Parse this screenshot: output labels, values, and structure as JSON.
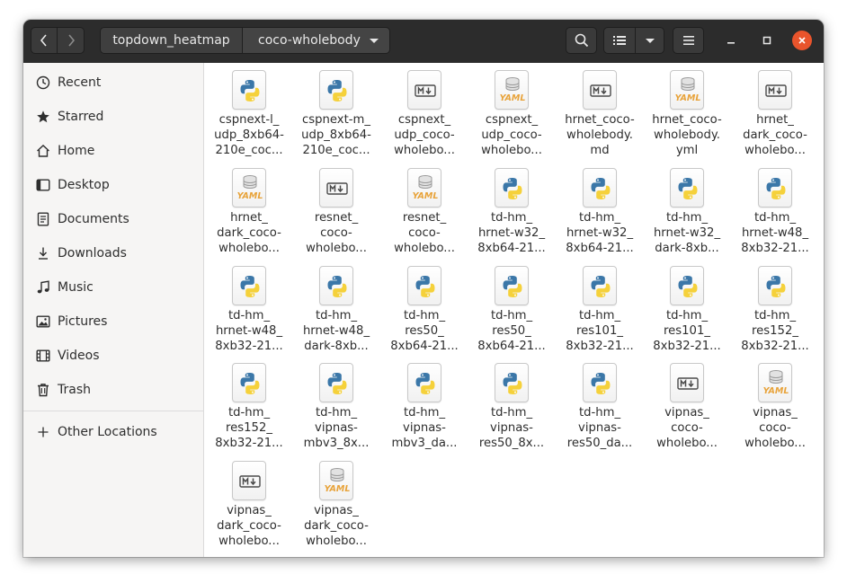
{
  "header": {
    "back_icon": "chevron-left-icon",
    "forward_icon": "chevron-right-icon",
    "breadcrumb": [
      "topdown_heatmap",
      "coco-wholebody"
    ],
    "search_icon": "search-icon",
    "view_icon": "list-view-icon",
    "view_dropdown_icon": "chevron-down-icon",
    "menu_icon": "hamburger-menu-icon",
    "minimize_icon": "minimize-icon",
    "maximize_icon": "maximize-icon",
    "close_icon": "close-icon",
    "close_color": "#e9542c"
  },
  "sidebar": {
    "items": [
      {
        "label": "Recent",
        "icon": "clock-icon"
      },
      {
        "label": "Starred",
        "icon": "star-icon"
      },
      {
        "label": "Home",
        "icon": "home-icon"
      },
      {
        "label": "Desktop",
        "icon": "desktop-icon"
      },
      {
        "label": "Documents",
        "icon": "document-icon"
      },
      {
        "label": "Downloads",
        "icon": "download-icon"
      },
      {
        "label": "Music",
        "icon": "music-icon"
      },
      {
        "label": "Pictures",
        "icon": "picture-icon"
      },
      {
        "label": "Videos",
        "icon": "video-icon"
      },
      {
        "label": "Trash",
        "icon": "trash-icon"
      }
    ],
    "other_locations": {
      "label": "Other Locations",
      "icon": "plus-icon"
    }
  },
  "files": [
    {
      "name": "cspnext-l_\nudp_8xb64-\n210e_coc...",
      "type": "python"
    },
    {
      "name": "cspnext-m_\nudp_8xb64-\n210e_coc...",
      "type": "python"
    },
    {
      "name": "cspnext_\nudp_coco-\nwholebo...",
      "type": "markdown"
    },
    {
      "name": "cspnext_\nudp_coco-\nwholebo...",
      "type": "yaml"
    },
    {
      "name": "hrnet_coco-\nwholebody.\nmd",
      "type": "markdown"
    },
    {
      "name": "hrnet_coco-\nwholebody.\nyml",
      "type": "yaml"
    },
    {
      "name": "hrnet_\ndark_coco-\nwholebo...",
      "type": "markdown"
    },
    {
      "name": "hrnet_\ndark_coco-\nwholebo...",
      "type": "yaml"
    },
    {
      "name": "resnet_\ncoco-\nwholebo...",
      "type": "markdown"
    },
    {
      "name": "resnet_\ncoco-\nwholebo...",
      "type": "yaml"
    },
    {
      "name": "td-hm_\nhrnet-w32_\n8xb64-21...",
      "type": "python"
    },
    {
      "name": "td-hm_\nhrnet-w32_\n8xb64-21...",
      "type": "python"
    },
    {
      "name": "td-hm_\nhrnet-w32_\ndark-8xb...",
      "type": "python"
    },
    {
      "name": "td-hm_\nhrnet-w48_\n8xb32-21...",
      "type": "python"
    },
    {
      "name": "td-hm_\nhrnet-w48_\n8xb32-21...",
      "type": "python"
    },
    {
      "name": "td-hm_\nhrnet-w48_\ndark-8xb...",
      "type": "python"
    },
    {
      "name": "td-hm_\nres50_\n8xb64-21...",
      "type": "python"
    },
    {
      "name": "td-hm_\nres50_\n8xb64-21...",
      "type": "python"
    },
    {
      "name": "td-hm_\nres101_\n8xb32-21...",
      "type": "python"
    },
    {
      "name": "td-hm_\nres101_\n8xb32-21...",
      "type": "python"
    },
    {
      "name": "td-hm_\nres152_\n8xb32-21...",
      "type": "python"
    },
    {
      "name": "td-hm_\nres152_\n8xb32-21...",
      "type": "python"
    },
    {
      "name": "td-hm_\nvipnas-\nmbv3_8x...",
      "type": "python"
    },
    {
      "name": "td-hm_\nvipnas-\nmbv3_da...",
      "type": "python"
    },
    {
      "name": "td-hm_\nvipnas-\nres50_8x...",
      "type": "python"
    },
    {
      "name": "td-hm_\nvipnas-\nres50_da...",
      "type": "python"
    },
    {
      "name": "vipnas_\ncoco-\nwholebo...",
      "type": "markdown"
    },
    {
      "name": "vipnas_\ncoco-\nwholebo...",
      "type": "yaml"
    },
    {
      "name": "vipnas_\ndark_coco-\nwholebo...",
      "type": "markdown"
    },
    {
      "name": "vipnas_\ndark_coco-\nwholebo...",
      "type": "yaml"
    }
  ],
  "icon_colors": {
    "python_blue": "#3b77a8",
    "python_yellow": "#f5d13b",
    "yaml_orange": "#e8a33a",
    "markdown_gray": "#4a4a4a"
  }
}
